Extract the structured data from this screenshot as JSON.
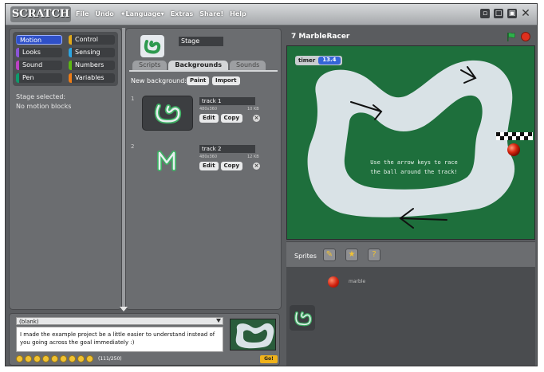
{
  "app": {
    "logo": "SCRATCH",
    "menus": [
      "File",
      "Undo",
      "Language",
      "Extras",
      "Share!",
      "Help"
    ]
  },
  "palette": {
    "categories": [
      "Motion",
      "Looks",
      "Sound",
      "Pen",
      "Control",
      "Sensing",
      "Numbers",
      "Variables"
    ],
    "category_colors": [
      "#4a6cd4",
      "#8a55d7",
      "#bb42c3",
      "#0e9a6c",
      "#e1a91a",
      "#2ca5e2",
      "#5cb712",
      "#ee7d16"
    ],
    "selected": "Motion",
    "info_line1": "Stage selected:",
    "info_line2": "No motion blocks"
  },
  "middle": {
    "stage_name": "Stage",
    "tabs": [
      "Scripts",
      "Backgrounds",
      "Sounds"
    ],
    "active_tab": "Backgrounds",
    "new_background_label": "New background:",
    "paint_label": "Paint",
    "import_label": "Import",
    "costumes": [
      {
        "num": "1",
        "name": "track 1",
        "dims": "480x360",
        "size": "10 KB",
        "edit": "Edit",
        "copy": "Copy"
      },
      {
        "num": "2",
        "name": "track 2",
        "dims": "480x360",
        "size": "12 KB",
        "edit": "Edit",
        "copy": "Copy"
      }
    ]
  },
  "stage": {
    "project_title": "7 MarbleRacer",
    "timer_label": "timer",
    "timer_value": "13.4",
    "instructions": "Use the arrow keys to race the ball around the track!",
    "bg_color": "#1e6f3c",
    "track_color": "#d9e2e6"
  },
  "sprites": {
    "label": "Sprites",
    "sprite_name": "marble"
  },
  "notes": {
    "selector": "(blank)",
    "text": "I made the example project be a little easier to understand instead of you going across the goal immediately :)",
    "char_count": "(111/250)",
    "go_label": "Go!"
  }
}
